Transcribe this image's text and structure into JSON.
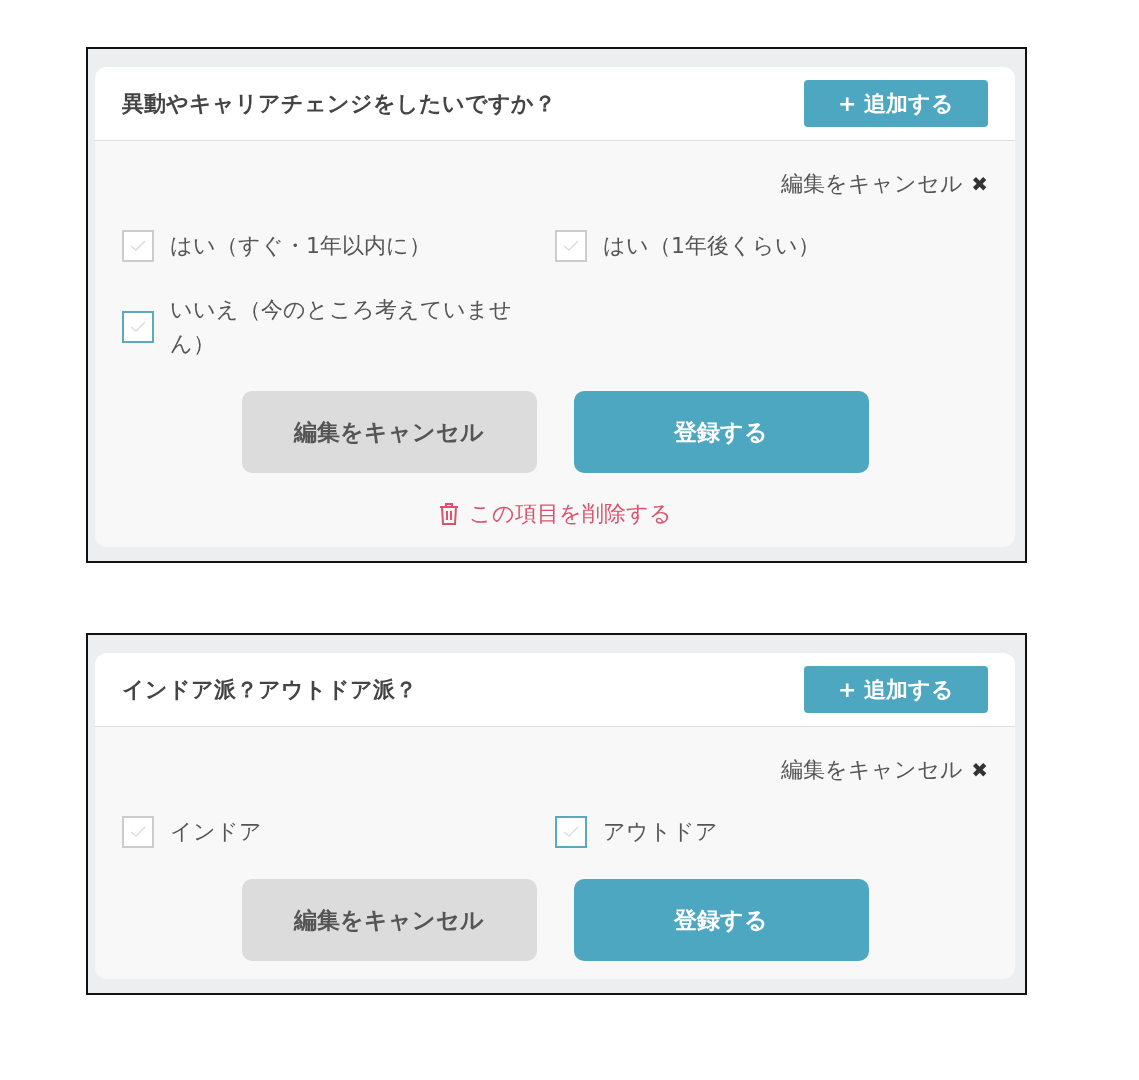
{
  "cards": [
    {
      "title": "異動やキャリアチェンジをしたいですか？",
      "add_button": "+ 追加する",
      "cancel_link": "編集をキャンセル",
      "close_icon": "✖",
      "options": [
        {
          "label": "はい（すぐ・1年以内に）",
          "checked": false,
          "highlighted": false
        },
        {
          "label": "はい（1年後くらい）",
          "checked": false,
          "highlighted": false
        },
        {
          "label": "いいえ（今のところ考えていません）",
          "checked": false,
          "highlighted": true
        }
      ],
      "buttons": [
        {
          "kind": "cancel",
          "label": "編集をキャンセル"
        },
        {
          "kind": "submit",
          "label": "登録する"
        }
      ],
      "delete_link": "この項目を削除する"
    },
    {
      "title": "インドア派？アウトドア派？",
      "add_button": "+ 追加する",
      "cancel_link": "編集をキャンセル",
      "close_icon": "✖",
      "options": [
        {
          "label": "インドア",
          "checked": false,
          "highlighted": false
        },
        {
          "label": "アウトドア",
          "checked": false,
          "highlighted": true
        }
      ],
      "buttons": [
        {
          "kind": "cancel",
          "label": "編集をキャンセル"
        },
        {
          "kind": "submit",
          "label": "登録する"
        }
      ]
    }
  ]
}
